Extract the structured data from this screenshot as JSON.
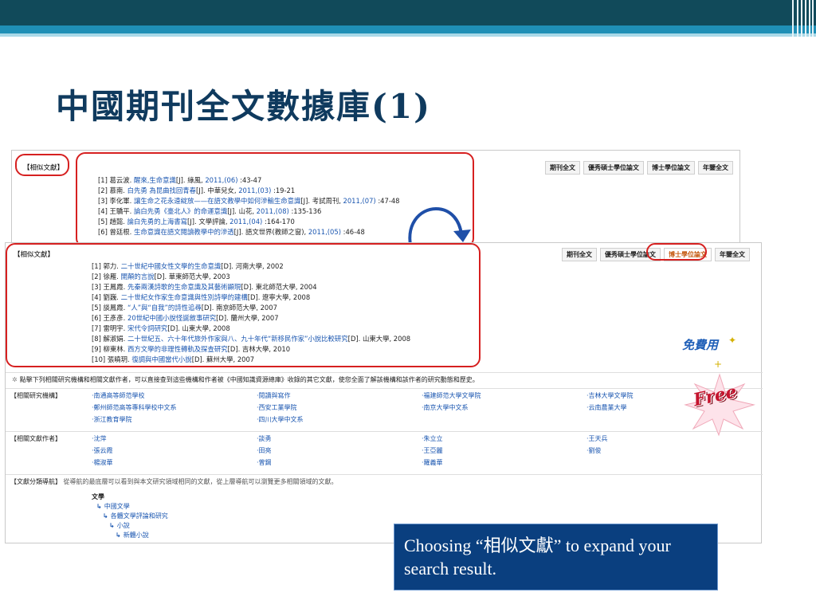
{
  "slide": {
    "title": "中國期刊全文數據庫(1)",
    "caption": "Choosing “相似文獻” to expand your search result."
  },
  "back_shot": {
    "tag": "【相似文獻】",
    "tabs": [
      {
        "label": "期刊全文",
        "active": true
      },
      {
        "label": "優秀碩士學位論文",
        "active": false
      },
      {
        "label": "博士學位論文",
        "active": false
      },
      {
        "label": "年鑒全文",
        "active": false
      }
    ],
    "refs": [
      {
        "pre": "[1] 葛云波. ",
        "link": "醒來,生命意識",
        "post": "[J]. 綠風, ",
        "link2": "2011,(06)",
        "tail": " :43-47"
      },
      {
        "pre": "[2] 慕南. ",
        "link": "白先勇 為昆曲找回青春",
        "post": "[J]. 中華兒女, ",
        "link2": "2011,(03)",
        "tail": " :19-21"
      },
      {
        "pre": "[3] 李化軍. ",
        "link": "讓生命之花永遠綻放——在語文教學中如何滲輸生命意識",
        "post": "[J]. 考試周刊, ",
        "link2": "2011,(07)",
        "tail": " :47-48"
      },
      {
        "pre": "[4] 王驕平. ",
        "link": "論白先勇《臺北人》的命運意識",
        "post": "[J]. 山花, ",
        "link2": "2011,(08)",
        "tail": " :135-136"
      },
      {
        "pre": "[5] 趙懿. ",
        "link": "論白先勇的上海書寫",
        "post": "[J]. 文學評論, ",
        "link2": "2011,(04)",
        "tail": " :164-170"
      },
      {
        "pre": "[6] 曾廷根. ",
        "link": "生命意識在語文閱讀教學中的滲透",
        "post": "[J]. 語文世界(教師之窗), ",
        "link2": "2011,(05)",
        "tail": " :46-48"
      }
    ]
  },
  "front_shot": {
    "tag": "【相似文獻】",
    "tabs": [
      {
        "label": "期刊全文",
        "active": false
      },
      {
        "label": "優秀碩士學位論文",
        "active": false
      },
      {
        "label": "博士學位論文",
        "active": true
      },
      {
        "label": "年鑒全文",
        "active": false
      }
    ],
    "refs": [
      {
        "pre": "[1] 郭力. ",
        "link": "二十世紀中國女性文學的生命意識",
        "post": "[D]. 河南大學, 2002"
      },
      {
        "pre": "[2] 徐雁. ",
        "link": "開顛的言說",
        "post": "[D]. 華東師范大學, 2003"
      },
      {
        "pre": "[3] 王鳳霞. ",
        "link": "先秦兩漢詩歌的生命意識及其藝術顯現",
        "post": "[D]. 東北師范大學, 2004"
      },
      {
        "pre": "[4] 劉巍. ",
        "link": "二十世紀女作家生命意識與性別詩學的建構",
        "post": "[D]. 遼寧大學, 2008"
      },
      {
        "pre": "[5] 談鳳霞. ",
        "link": "“人”與“自我”的詩性追尋",
        "post": "[D]. 南京師范大學, 2007"
      },
      {
        "pre": "[6] 王彥彥. ",
        "link": "20世紀中國小說怪誕敘事研究",
        "post": "[D]. 蘭州大學, 2007"
      },
      {
        "pre": "[7] 雷明宇. ",
        "link": "宋代令詞研究",
        "post": "[D]. 山東大學, 2008"
      },
      {
        "pre": "[8] 解淑娟. ",
        "link": "二十世紀五、六十年代旅外作家與八、九十年代“新移民作家”小說比較研究",
        "post": "[D]. 山東大學, 2008"
      },
      {
        "pre": "[9] 柳東林. ",
        "link": "西方文學的非理性轉軌及探查研究",
        "post": "[D]. 吉林大學, 2010"
      },
      {
        "pre": "[10] 張曉玥. ",
        "link": "復調與中國當代小說",
        "post": "[D]. 蘇州大學, 2007"
      }
    ],
    "notice": "點擊下列相關研究機構和相關文獻作者，可以直接查到這些機構和作者被《中國知識資源總庫》收錄的其它文獻，使您全面了解該機構和該作者的研究動態和歷史。",
    "institutions": {
      "label": "【相關研究機構】",
      "items": [
        "·南通高等師范學校",
        "·閱讀與寫作",
        "·福建師范大學文學院",
        "·吉林大學文學院",
        "·鄭州師范高等專科學校中文系",
        "·西安工業學院",
        "·南京大學中文系",
        "·云南農業大學",
        "·浙江教育學院",
        "·四川大學中文系"
      ]
    },
    "authors": {
      "label": "【相關文獻作者】",
      "items": [
        "·沈萍",
        "·談勇",
        "·朱立立",
        "·王天兵",
        "·張云霞",
        "·田亮",
        "·王亞麗",
        "·劉俊",
        "·楊淑華",
        "·曾鋼",
        "·羅義華"
      ]
    },
    "nav": {
      "label": "【文獻分類導航】",
      "desc": "從導航的最底層可以看到與本文研究領域相同的文獻，從上層導航可以瀏覽更多相關領域的文獻。"
    },
    "tree": [
      "文學",
      "中國文學",
      "各體文學評論和研究",
      "小說",
      "新體小說"
    ]
  },
  "decor": {
    "free_cn": "免費用",
    "free_en": "Free"
  },
  "colors": {
    "header_dark": "#114a5a",
    "header_mid": "#1f8fb6",
    "caption_bg": "#0a3f7f",
    "callout_red": "#d62020",
    "link_blue": "#1a56b0",
    "active_tab": "#c55a11"
  }
}
